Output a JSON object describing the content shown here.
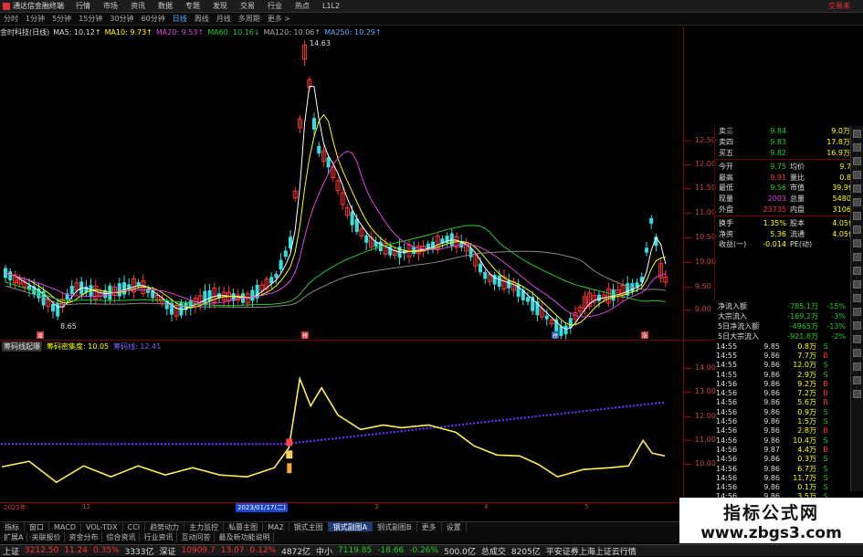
{
  "menubar": {
    "app_title": "通达信金融终端",
    "items": [
      "行情",
      "市场",
      "资讯",
      "数据",
      "专题",
      "发现",
      "交易",
      "行业",
      "热点",
      "L1L2"
    ],
    "login": "交易未"
  },
  "periods": {
    "items": [
      "分时",
      "1分钟",
      "5分钟",
      "15分钟",
      "30分钟",
      "60分钟",
      "日线",
      "周线",
      "月线",
      "多周期",
      "更多 >"
    ],
    "active": "日线"
  },
  "ma_bar": {
    "name": "金时科技(日线)",
    "ma5": "MA5: 10.12↑",
    "ma10": "MA10: 9.73↑",
    "ma20": "MA20: 9.53↑",
    "ma60": "MA60: 10.16↓",
    "ma120": "MA120: 10.06↑",
    "ma250": "MA250: 10.29↑"
  },
  "main_chart": {
    "high_label": "14.63",
    "low_label": "8.65",
    "markers": [
      "增",
      "榜",
      "榜",
      "涨"
    ]
  },
  "main_axis": [
    "12.50",
    "12.00",
    "11.50",
    "11.00",
    "10.50",
    "10.00",
    "9.50",
    "9.00"
  ],
  "sub_header": {
    "name": "筹码线起爆",
    "item1": "筹码密集度: 10.05",
    "item2": "筹码线: 12.41"
  },
  "sub_axis": [
    "14.00",
    "13.00",
    "12.00",
    "11.00",
    "10.00"
  ],
  "quote": {
    "rows": [
      {
        "k": "卖三",
        "v": "9.84",
        "v2": "9.0万"
      },
      {
        "k": "卖四",
        "v": "9.83",
        "v2": "17.8万"
      },
      {
        "k": "买五",
        "v": "9.82",
        "v2": "16.9万"
      }
    ],
    "stats": [
      {
        "k": "今开",
        "v": "9.75",
        "k2": "均价",
        "v2": "9.73"
      },
      {
        "k": "最高",
        "v": "9.91",
        "k2": "量比",
        "v2": "0.82"
      },
      {
        "k": "最低",
        "v": "9.56",
        "k2": "市值",
        "v2": "39.9亿"
      },
      {
        "k": "现量",
        "v": "2003",
        "k2": "总量",
        "v2": "54802"
      },
      {
        "k": "外盘",
        "v": "23735",
        "k2": "内盘",
        "v2": "31067"
      },
      {
        "k": "换手",
        "v": "1.35%",
        "k2": "股本",
        "v2": "4.05亿"
      },
      {
        "k": "净资",
        "v": "5.36",
        "k2": "流通",
        "v2": "4.05亿"
      },
      {
        "k": "收益(一)",
        "v": "-0.014",
        "k2": "PE(动)",
        "v2": "-"
      }
    ]
  },
  "flow": [
    {
      "k": "净流入额",
      "v": "-785.1万",
      "p": "-15%"
    },
    {
      "k": "大宗流入",
      "v": "-169.2万",
      "p": "-3%"
    },
    {
      "k": "5日净流入额",
      "v": "-4965万",
      "p": "-13%"
    },
    {
      "k": "5日大宗流入",
      "v": "-921.8万",
      "p": "-2%"
    }
  ],
  "ticks": [
    {
      "t": "14:55",
      "p": "9.85",
      "q": "0.8万",
      "s": "S"
    },
    {
      "t": "14:55",
      "p": "9.86",
      "q": "7.7万",
      "s": "B"
    },
    {
      "t": "14:55",
      "p": "9.86",
      "q": "12.0万",
      "s": "S"
    },
    {
      "t": "14:55",
      "p": "9.86",
      "q": "2.9万",
      "s": "S"
    },
    {
      "t": "14:56",
      "p": "9.86",
      "q": "9.2万",
      "s": "B"
    },
    {
      "t": "14:56",
      "p": "9.86",
      "q": "7.2万",
      "s": "B"
    },
    {
      "t": "14:56",
      "p": "9.86",
      "q": "5.6万",
      "s": "B"
    },
    {
      "t": "14:56",
      "p": "9.86",
      "q": "0.9万",
      "s": "S"
    },
    {
      "t": "14:56",
      "p": "9.86",
      "q": "1.5万",
      "s": "S"
    },
    {
      "t": "14:56",
      "p": "9.86",
      "q": "2.8万",
      "s": "B"
    },
    {
      "t": "14:56",
      "p": "9.86",
      "q": "10.4万",
      "s": "S"
    },
    {
      "t": "14:56",
      "p": "9.87",
      "q": "4.4万",
      "s": "B"
    },
    {
      "t": "14:56",
      "p": "9.86",
      "q": "0.3万",
      "s": "S"
    },
    {
      "t": "14:56",
      "p": "9.86",
      "q": "6.7万",
      "s": "S"
    },
    {
      "t": "14:56",
      "p": "9.86",
      "q": "11.7万",
      "s": "S"
    },
    {
      "t": "14:56",
      "p": "9.86",
      "q": "0.1万",
      "s": "S"
    },
    {
      "t": "14:56",
      "p": "9.86",
      "q": "3.5万",
      "s": "S"
    }
  ],
  "time_axis": {
    "labels": [
      "2022年",
      "12",
      "2023/01/17(二)",
      "3",
      "4",
      "5"
    ]
  },
  "tabs": [
    "指标",
    "窗口",
    "MACD",
    "VOL-TDX",
    "CCI",
    "趋势动力",
    "主力监控",
    "私募主图",
    "MA2",
    "钢式主图",
    "钢式副图A",
    "钢式副图B",
    "更多",
    "设置"
  ],
  "tabs_active": "钢式副图A",
  "tabs2": [
    "扩展A",
    "关联报价",
    "资金分布",
    "综合资讯",
    "行业资讯",
    "互动问答",
    "最及新功能说明"
  ],
  "status": {
    "sh": "上证",
    "sh_v": "3212.50",
    "sh_c": "11.24",
    "sh_p": "0.35%",
    "sh_a": "3333亿",
    "sz": "深证",
    "sz_v": "10909.7",
    "sz_c": "13.07",
    "sz_p": "0.12%",
    "sz_a": "4872亿",
    "zx": "中小",
    "zx_v": "7119.85",
    "zx_c": "-18.66",
    "zx_p": "-0.26%",
    "zx_a": "500.0亿",
    "total": "总成交",
    "total_v": "8205亿",
    "broker": "平安证券上海上证云行情"
  },
  "watermark": {
    "a": "指标公式网",
    "b": "www.zbgs3.com"
  },
  "colors": {
    "up": "#ff3333",
    "down": "#33e0e0",
    "ma5": "#ffffff",
    "ma10": "#ffff00",
    "ma20": "#dd44dd",
    "ma60": "#22cc22",
    "ma120": "#888888",
    "sub_line": "#ffee55",
    "sub_dots": "#6633ff"
  }
}
